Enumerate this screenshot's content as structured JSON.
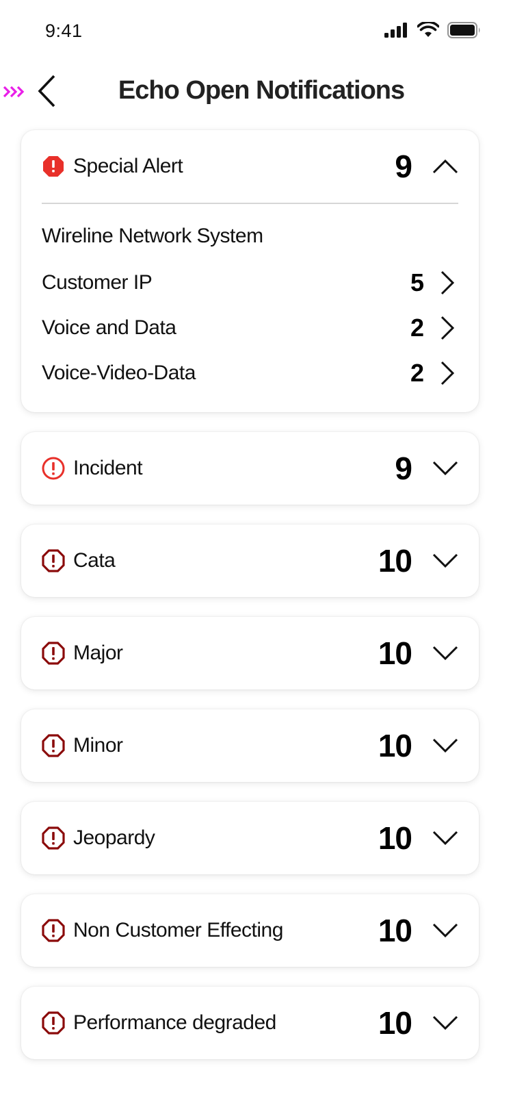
{
  "status_bar": {
    "time": "9:41"
  },
  "header": {
    "title": "Echo Open Notifications",
    "marker_icon": "triple-chevron-right-icon",
    "marker_color": "#e91ee8",
    "back_icon": "chevron-left-icon"
  },
  "colors": {
    "special_alert": "#e8302a",
    "incident": "#e8302a",
    "severity": "#8b0b0b"
  },
  "special_alert": {
    "label": "Special Alert",
    "count": "9",
    "expanded": true,
    "section_title": "Wireline Network System",
    "items": [
      {
        "label": "Customer IP",
        "count": "5"
      },
      {
        "label": "Voice and Data",
        "count": "2"
      },
      {
        "label": "Voice-Video-Data",
        "count": "2"
      }
    ]
  },
  "categories": [
    {
      "label": "Incident",
      "count": "9",
      "icon": "exclamation-circle-icon"
    },
    {
      "label": "Cata",
      "count": "10",
      "icon": "exclamation-octagon-icon"
    },
    {
      "label": "Major",
      "count": "10",
      "icon": "exclamation-octagon-icon"
    },
    {
      "label": "Minor",
      "count": "10",
      "icon": "exclamation-octagon-icon"
    },
    {
      "label": "Jeopardy",
      "count": "10",
      "icon": "exclamation-octagon-icon"
    },
    {
      "label": "Non Customer Effecting",
      "count": "10",
      "icon": "exclamation-octagon-icon"
    },
    {
      "label": "Performance degraded",
      "count": "10",
      "icon": "exclamation-octagon-icon"
    }
  ]
}
